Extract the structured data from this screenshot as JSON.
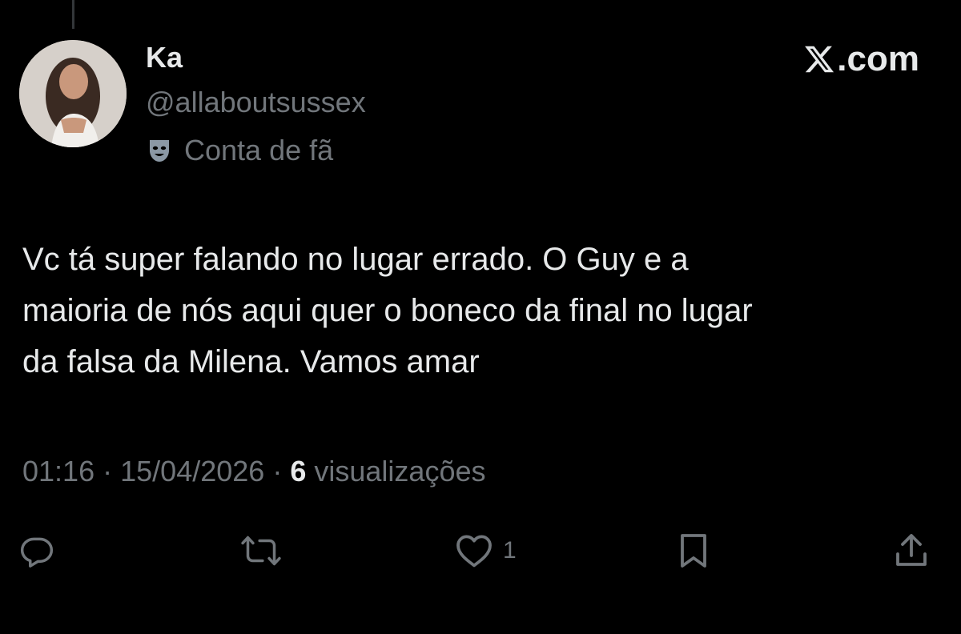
{
  "tweet": {
    "display_name": "Ka",
    "handle": "@allaboutsussex",
    "fan_label": "Conta de fã",
    "text": "Vc tá super falando no lugar errado. O Guy e a\nmaioria de nós aqui quer o boneco da final no lugar\nda falsa da Milena. Vamos amar",
    "time": "01:16",
    "separator": "·",
    "date": "15/04/2026",
    "views_count": "6",
    "views_label": "visualizações"
  },
  "brand": {
    "domain": ".com",
    "icon": "x-logo-icon"
  },
  "actions": {
    "reply": {
      "icon": "reply-icon",
      "count": ""
    },
    "retweet": {
      "icon": "retweet-icon",
      "count": ""
    },
    "like": {
      "icon": "heart-icon",
      "count": "1"
    },
    "bookmark": {
      "icon": "bookmark-icon",
      "count": ""
    },
    "share": {
      "icon": "share-icon",
      "count": ""
    }
  },
  "colors": {
    "background": "#000000",
    "text_primary": "#e7e9ea",
    "text_secondary": "#71767b",
    "thread_line": "#333639"
  }
}
